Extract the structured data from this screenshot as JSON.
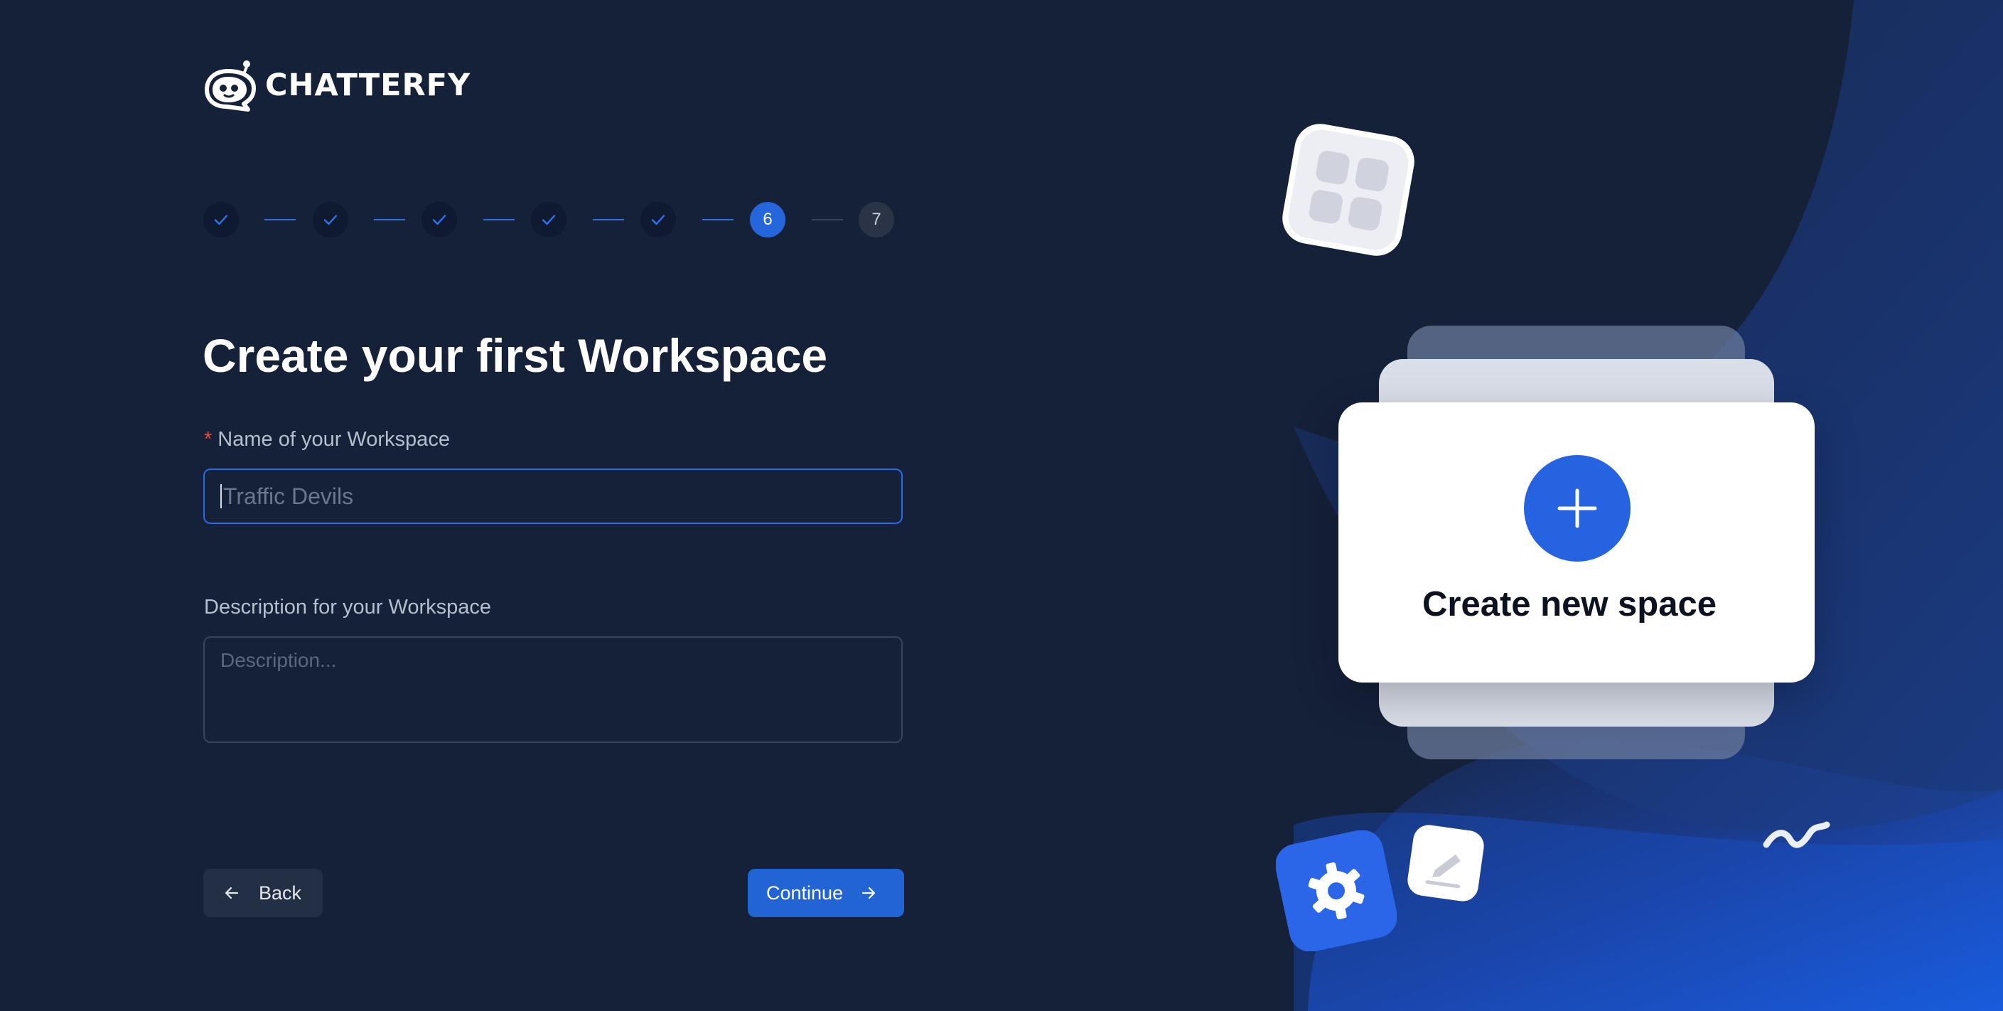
{
  "brand": {
    "name": "CHATTERFY",
    "logo_icon": "robot-chat-bubble-icon"
  },
  "stepper": {
    "steps": [
      {
        "state": "done",
        "label": ""
      },
      {
        "state": "done",
        "label": ""
      },
      {
        "state": "done",
        "label": ""
      },
      {
        "state": "done",
        "label": ""
      },
      {
        "state": "done",
        "label": ""
      },
      {
        "state": "active",
        "label": "6"
      },
      {
        "state": "pending",
        "label": "7"
      }
    ]
  },
  "form": {
    "title": "Create your first Workspace",
    "required_mark": "*",
    "name_label": "Name of your Workspace",
    "name_placeholder": "Traffic Devils",
    "description_label": "Description for your Workspace",
    "description_placeholder": "Description..."
  },
  "buttons": {
    "back_label": "Back",
    "continue_label": "Continue"
  },
  "illustration": {
    "card_title": "Create new space"
  },
  "colors": {
    "background": "#152039",
    "accent": "#2566dc",
    "required": "#f0473c"
  }
}
